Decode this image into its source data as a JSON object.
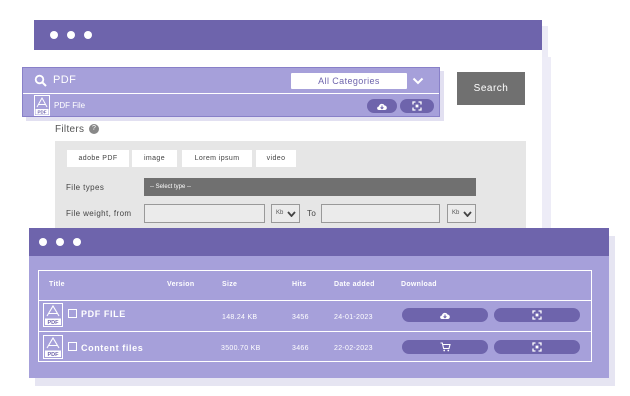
{
  "search": {
    "query": "PDF",
    "category": "All Categories",
    "file_label": "PDF File",
    "button_label": "Search",
    "pdf_icon_text": "PDF"
  },
  "filters": {
    "title": "Filters",
    "help_symbol": "?",
    "tags": [
      "adobe PDF",
      "image",
      "Lorem ipsum",
      "video"
    ],
    "file_types_label": "File types",
    "file_types_placeholder": "-- Select type --",
    "weight_from_label": "File weight, from",
    "weight_to_label": "To",
    "unit": "Kb"
  },
  "table": {
    "headers": {
      "title": "Title",
      "version": "Version",
      "size": "Size",
      "hits": "Hits",
      "date": "Date added",
      "download": "Download"
    },
    "rows": [
      {
        "title": "PDF FILE",
        "size": "148.24 KB",
        "hits": "3456",
        "date": "24-01-2023",
        "action_icon": "cloud-download-icon"
      },
      {
        "title": "Content files",
        "size": "3500.70 KB",
        "hits": "3466",
        "date": "22-02-2023",
        "action_icon": "cart-icon"
      }
    ],
    "pdf_icon_text": "PDF"
  },
  "colors": {
    "accent_dark": "#6e64ac",
    "accent_light": "#a6a0da",
    "gray_button": "#707070",
    "filter_bg": "#e6e6e6"
  }
}
